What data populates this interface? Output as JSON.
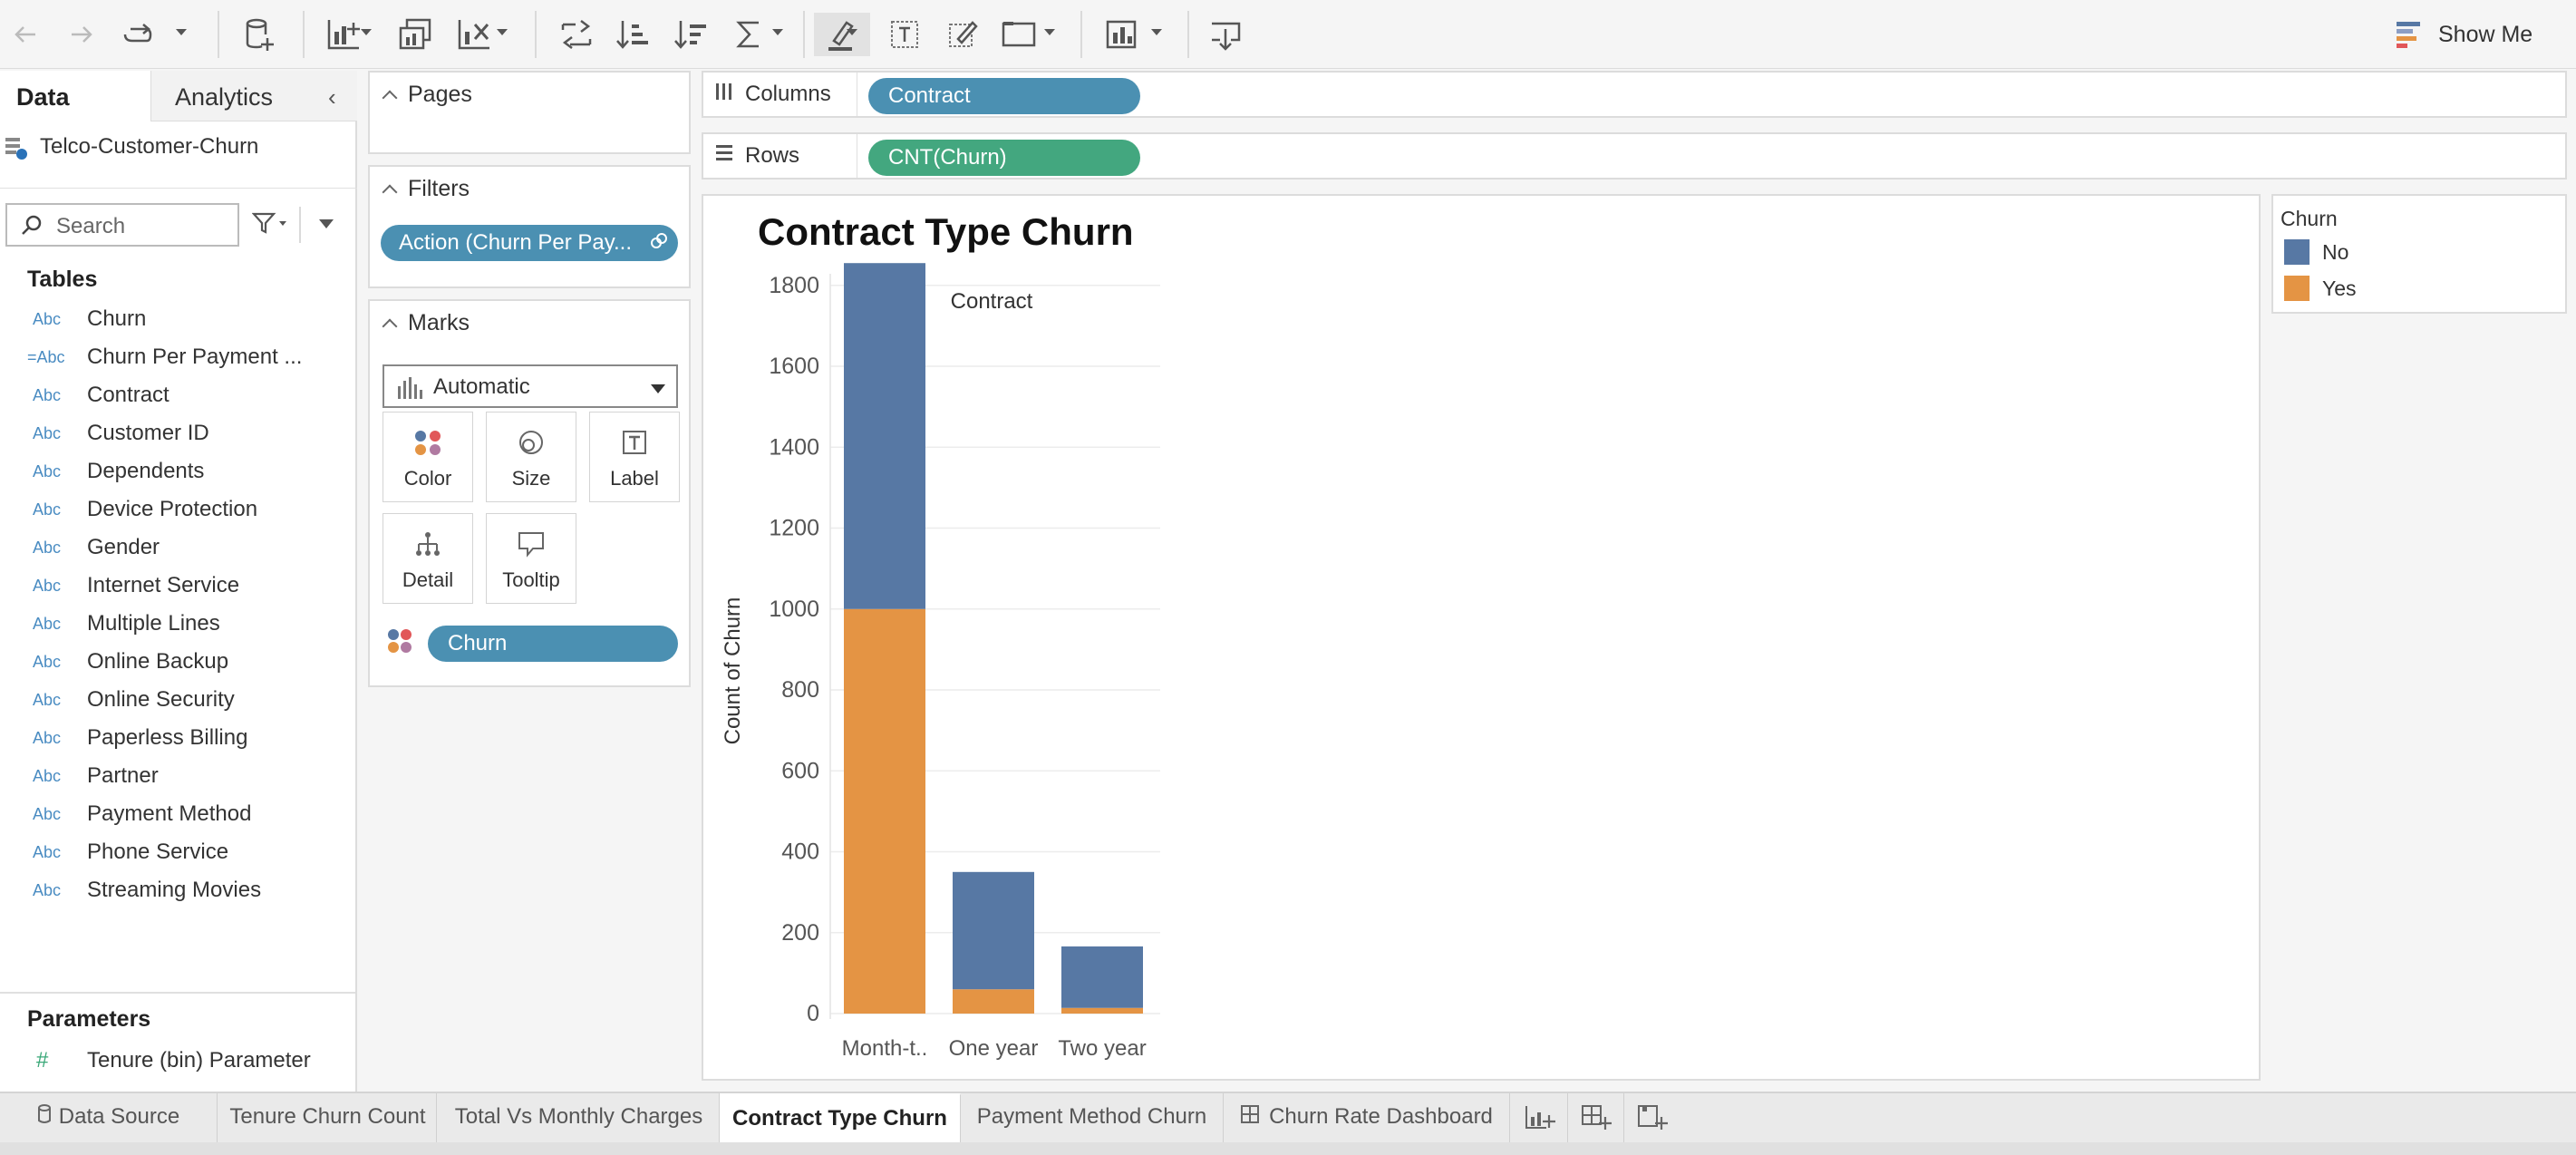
{
  "toolbar": {
    "show_me_label": "Show Me",
    "icons": [
      "back-icon",
      "forward-icon",
      "redo-icon",
      "new-datasource-icon",
      "new-worksheet-icon",
      "duplicate-icon",
      "clear-sheet-icon",
      "swap-icon",
      "sort-ascending-icon",
      "sort-descending-icon",
      "totals-icon",
      "highlight-icon",
      "labels-icon",
      "annotate-icon",
      "fit-icon",
      "presentation-icon",
      "download-icon"
    ]
  },
  "data_pane": {
    "tab_data": "Data",
    "tab_analytics": "Analytics",
    "datasource": "Telco-Customer-Churn",
    "search_placeholder": "Search",
    "tables_heading": "Tables",
    "fields": [
      {
        "type": "Abc",
        "name": "Churn"
      },
      {
        "type": "=Abc",
        "name": "Churn Per Payment ..."
      },
      {
        "type": "Abc",
        "name": "Contract"
      },
      {
        "type": "Abc",
        "name": "Customer ID"
      },
      {
        "type": "Abc",
        "name": "Dependents"
      },
      {
        "type": "Abc",
        "name": "Device Protection"
      },
      {
        "type": "Abc",
        "name": "Gender"
      },
      {
        "type": "Abc",
        "name": "Internet Service"
      },
      {
        "type": "Abc",
        "name": "Multiple Lines"
      },
      {
        "type": "Abc",
        "name": "Online Backup"
      },
      {
        "type": "Abc",
        "name": "Online Security"
      },
      {
        "type": "Abc",
        "name": "Paperless Billing"
      },
      {
        "type": "Abc",
        "name": "Partner"
      },
      {
        "type": "Abc",
        "name": "Payment Method"
      },
      {
        "type": "Abc",
        "name": "Phone Service"
      },
      {
        "type": "Abc",
        "name": "Streaming Movies"
      }
    ],
    "parameters_heading": "Parameters",
    "parameter": {
      "type": "#",
      "name": "Tenure (bin) Parameter"
    }
  },
  "pages_card": {
    "title": "Pages"
  },
  "filters_card": {
    "title": "Filters",
    "filter_pill": "Action (Churn Per Pay..."
  },
  "marks_card": {
    "title": "Marks",
    "mark_type": "Automatic",
    "buttons": {
      "color": "Color",
      "size": "Size",
      "label": "Label",
      "detail": "Detail",
      "tooltip": "Tooltip"
    },
    "color_pill": "Churn"
  },
  "shelves": {
    "columns_label": "Columns",
    "columns_pill": "Contract",
    "rows_label": "Rows",
    "rows_pill": "CNT(Churn)"
  },
  "colors": {
    "no": "#5778a4",
    "yes": "#e49444",
    "pill_blue": "#4b90b2",
    "pill_green": "#43a77f"
  },
  "legend": {
    "title": "Churn",
    "items": [
      {
        "label": "No",
        "color": "#5778a4"
      },
      {
        "label": "Yes",
        "color": "#e49444"
      }
    ]
  },
  "chart_data": {
    "type": "bar",
    "stacked": true,
    "title": "Contract Type Churn",
    "column_header": "Contract",
    "ylabel": "Count of Churn",
    "xlabel": "",
    "categories": [
      "Month-t..",
      "One year",
      "Two year"
    ],
    "series": [
      {
        "name": "Yes",
        "color": "#e49444",
        "values": [
          1000,
          60,
          14
        ]
      },
      {
        "name": "No",
        "color": "#5778a4",
        "values": [
          855,
          290,
          152
        ]
      }
    ],
    "ylim": [
      0,
      1900
    ],
    "yticks": [
      0,
      200,
      400,
      600,
      800,
      1000,
      1200,
      1400,
      1600,
      1800
    ],
    "grid": true
  },
  "sheet_tabs": {
    "data_source": "Data Source",
    "tabs": [
      {
        "label": "Tenure Churn Count",
        "active": false
      },
      {
        "label": "Total Vs Monthly Charges",
        "active": false
      },
      {
        "label": "Contract Type Churn",
        "active": true
      },
      {
        "label": "Payment Method Churn",
        "active": false
      },
      {
        "label": "Churn Rate Dashboard",
        "active": false
      }
    ]
  }
}
